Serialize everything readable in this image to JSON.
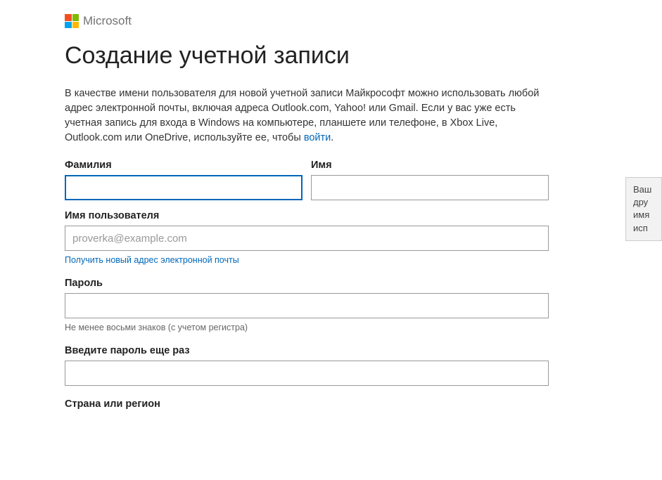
{
  "brand": "Microsoft",
  "heading": "Создание учетной записи",
  "intro": {
    "text_before_link": "В качестве имени пользователя для новой учетной записи Майкрософт можно использовать любой адрес электронной почты, включая адреса Outlook.com, Yahoo! или Gmail. Если у вас уже есть учетная запись для входа в Windows на компьютере, планшете или телефоне, в Xbox Live, Outlook.com или OneDrive, используйте ее, чтобы ",
    "link": "войти",
    "after": "."
  },
  "fields": {
    "lastname_label": "Фамилия",
    "lastname_value": "",
    "firstname_label": "Имя",
    "firstname_value": "",
    "username_label": "Имя пользователя",
    "username_placeholder": "proverka@example.com",
    "username_value": "",
    "new_email_link": "Получить новый адрес электронной почты",
    "password_label": "Пароль",
    "password_value": "",
    "password_hint": "Не менее восьми знаков (с учетом регистра)",
    "password_confirm_label": "Введите пароль еще раз",
    "password_confirm_value": "",
    "country_label": "Страна или регион"
  },
  "tooltip": {
    "line1": "Ваш",
    "line2": "дру",
    "line3": "имя",
    "line4": "исп"
  }
}
